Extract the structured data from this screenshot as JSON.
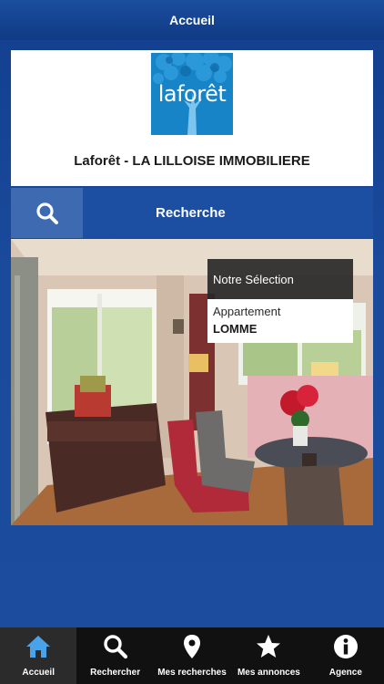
{
  "navbar": {
    "title": "Accueil"
  },
  "agency": {
    "logo_text": "laforêt",
    "name": "Laforêt - LA LILLOISE IMMOBILIERE"
  },
  "search": {
    "label": "Recherche",
    "icon": "search-icon"
  },
  "featured": {
    "selection_label": "Notre Sélection",
    "property_type": "Appartement",
    "city": "LOMME"
  },
  "tabs": [
    {
      "label": "Accueil",
      "icon": "home-icon",
      "active": true
    },
    {
      "label": "Rechercher",
      "icon": "search-icon",
      "active": false
    },
    {
      "label": "Mes recherches",
      "icon": "map-pin-icon",
      "active": false
    },
    {
      "label": "Mes annonces",
      "icon": "star-icon",
      "active": false
    },
    {
      "label": "Agence",
      "icon": "info-icon",
      "active": false
    }
  ],
  "colors": {
    "background": "#1b4c9e",
    "tab_active": "#4aa3e8",
    "tabbar": "#111111",
    "logo": "#1784c7"
  }
}
